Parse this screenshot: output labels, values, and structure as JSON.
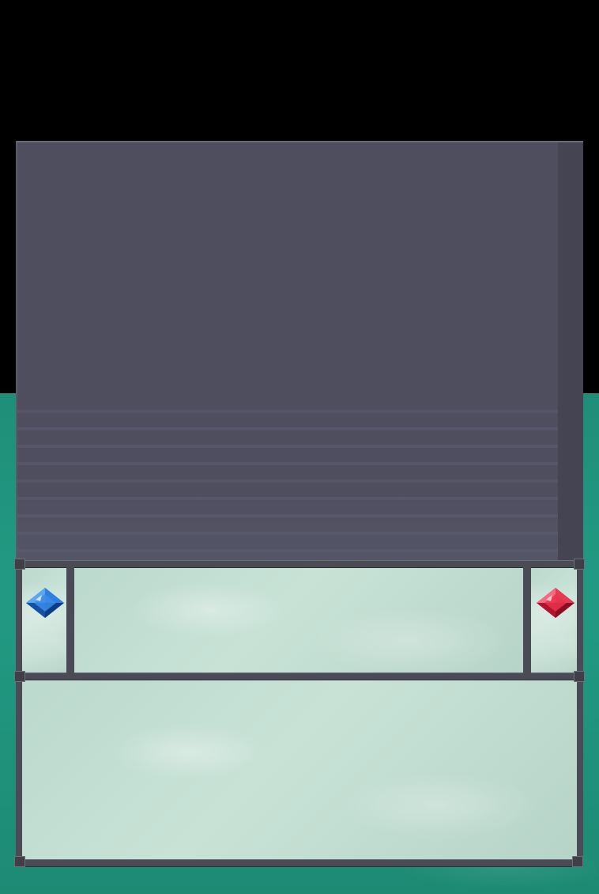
{
  "screen": {
    "background_color": "#000000",
    "backdrop_color": "#229a83",
    "display_panel_color": "#4f4e5e",
    "frame_color": "#4b4b55",
    "glass_color": "#c2ddd1"
  },
  "left_indicator": {
    "icon": "blue-gem-icon",
    "color": "#1f6fd6"
  },
  "right_indicator": {
    "icon": "red-gem-icon",
    "color": "#e0233f"
  },
  "message_box": {
    "text": ""
  },
  "info_box": {
    "text": ""
  }
}
